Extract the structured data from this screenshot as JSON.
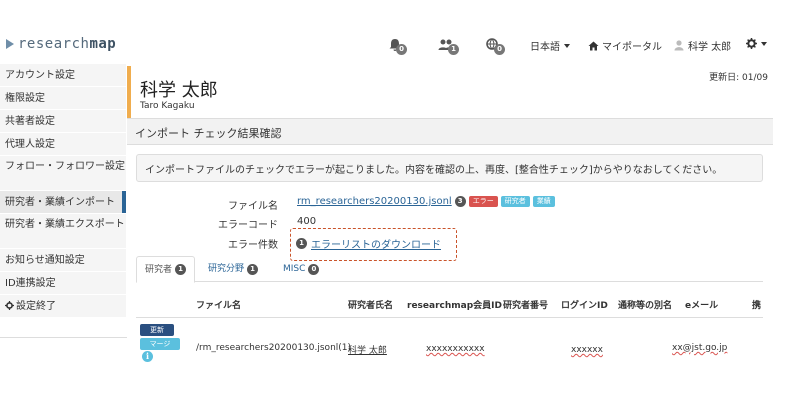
{
  "navbar": {
    "logo_prefix": "research",
    "logo_suffix": "map",
    "notifications_count": "0",
    "followers_count": "1",
    "unknown_count": "0",
    "language": "日本語",
    "my_portal": "マイポータル",
    "user_name": "科学 太郎"
  },
  "sidebar": {
    "items": [
      {
        "label": "アカウント設定"
      },
      {
        "label": "権限設定"
      },
      {
        "label": "共著者設定"
      },
      {
        "label": "代理人設定"
      },
      {
        "label": "フォロー・フォロワー設定"
      },
      {
        "label": "研究者・業績インポート"
      },
      {
        "label": "研究者・業績エクスポート"
      },
      {
        "label": "お知らせ通知設定"
      },
      {
        "label": "ID連携設定"
      },
      {
        "label": "設定終了"
      }
    ]
  },
  "profile": {
    "name_jp": "科学 太郎",
    "name_en": "Taro Kagaku",
    "updated": "更新日: 01/09"
  },
  "section": {
    "title": "インポート チェック結果確認"
  },
  "alert": {
    "message": "インポートファイルのチェックでエラーが起こりました。内容を確認の上、再度、[整合性チェック]からやりなおしてください。"
  },
  "info": {
    "filename_label": "ファイル名",
    "filename_value": "rm_researchers20200130.jsonl",
    "filename_count": "3",
    "tag_error": "エラー",
    "tag_researcher": "研究者",
    "tag_field": "業績",
    "errorcode_label": "エラーコード",
    "errorcode_value": "400",
    "errorcount_label": "エラー件数",
    "errorcount_value": "1",
    "download_link": "エラーリストのダウンロード"
  },
  "tabs": [
    {
      "label": "研究者",
      "count": "1"
    },
    {
      "label": "研究分野",
      "count": "1"
    },
    {
      "label": "MISC",
      "count": "0"
    }
  ],
  "table": {
    "headers": [
      "ファイル名",
      "研究者氏名",
      "researchmap会員ID",
      "研究者番号",
      "ログインID",
      "通称等の別名",
      "eメール",
      "携"
    ],
    "row": {
      "update_label": "更新",
      "merge_label": "マージ",
      "info_icon": "i",
      "filename": "/rm_researchers20200130.jsonl(1)",
      "name": "科学 太郎",
      "member_id": "xxxxxxxxxxx",
      "login_id": "xxxxxx",
      "email": "xx@jst.go.jp"
    }
  }
}
